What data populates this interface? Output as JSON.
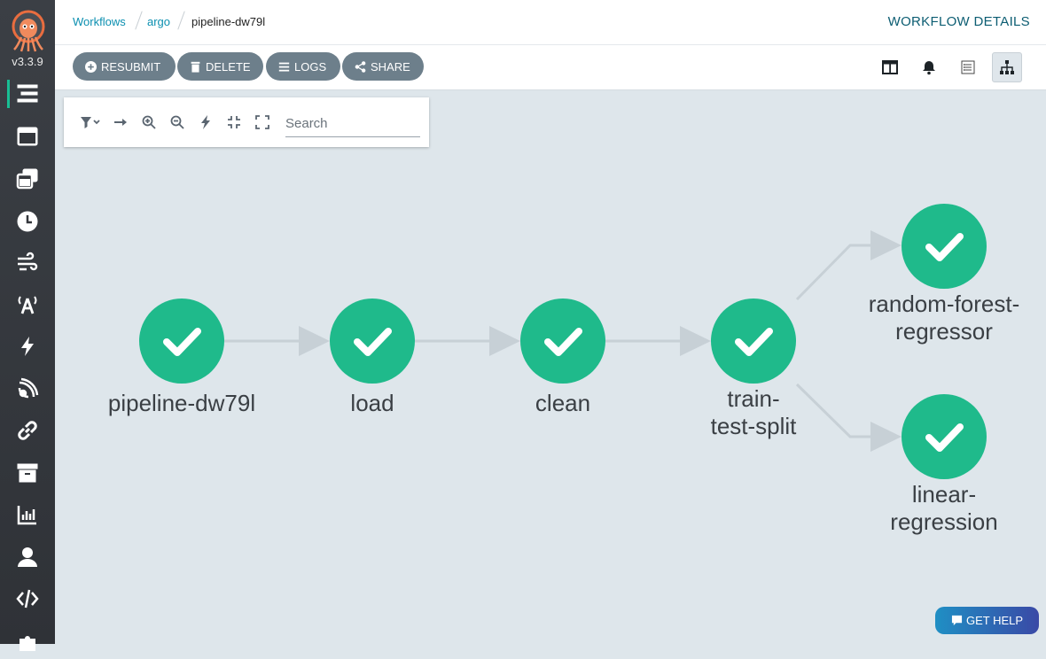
{
  "app": {
    "version": "v3.3.9"
  },
  "breadcrumb": {
    "items": [
      "Workflows",
      "argo",
      "pipeline-dw79l"
    ]
  },
  "page_title": "WORKFLOW DETAILS",
  "toolbar": {
    "resubmit": "RESUBMIT",
    "delete": "DELETE",
    "logs": "LOGS",
    "share": "SHARE"
  },
  "graph_controls": {
    "search_placeholder": "Search"
  },
  "nodes": [
    {
      "label": "pipeline-dw79l",
      "status": "succeeded"
    },
    {
      "label": "load",
      "status": "succeeded"
    },
    {
      "label": "clean",
      "status": "succeeded"
    },
    {
      "label": "train-\ntest-split",
      "status": "succeeded"
    },
    {
      "label": "random-forest-\nregressor",
      "status": "succeeded"
    },
    {
      "label": "linear-\nregression",
      "status": "succeeded"
    }
  ],
  "help": {
    "label": "GET HELP"
  },
  "colors": {
    "success": "#1fba8b",
    "link": "#0b8fb0",
    "button": "#6d7f8b",
    "sidebar": "#34373c",
    "canvas": "#dee6eb",
    "active_accent": "#18be94"
  }
}
